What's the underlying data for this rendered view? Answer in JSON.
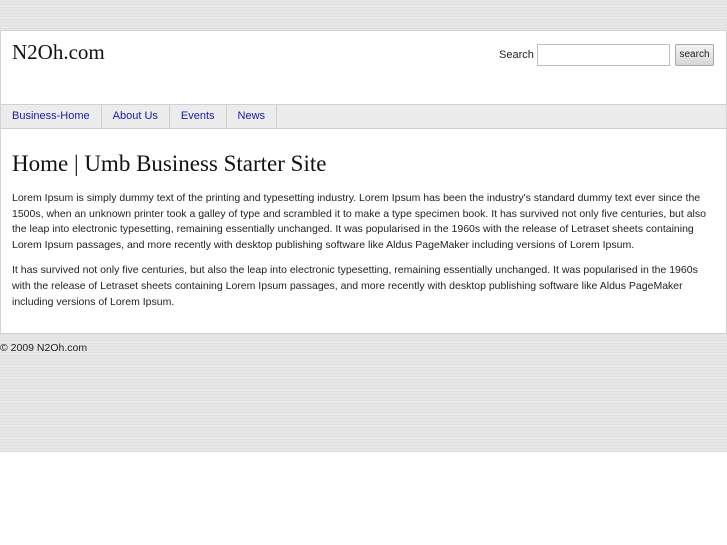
{
  "header": {
    "site_title": "N2Oh.com",
    "search_label": "Search",
    "search_value": "",
    "search_button": "search"
  },
  "nav": {
    "items": [
      {
        "label": "Business-Home"
      },
      {
        "label": "About Us"
      },
      {
        "label": "Events"
      },
      {
        "label": "News"
      }
    ]
  },
  "main": {
    "title": "Home | Umb Business Starter Site",
    "paragraphs": [
      "Lorem Ipsum is simply dummy text of the printing and typesetting industry. Lorem Ipsum has been the industry's standard dummy text ever since the 1500s, when an unknown printer took a galley of type and scrambled it to make a type specimen book. It has survived not only five centuries, but also the leap into electronic typesetting, remaining essentially unchanged. It was popularised in the 1960s with the release of Letraset sheets containing Lorem Ipsum passages, and more recently with desktop publishing software like Aldus PageMaker including versions of Lorem Ipsum.",
      "It has survived not only five centuries, but also the leap into electronic typesetting, remaining essentially unchanged. It was popularised in the 1960s with the release of Letraset sheets containing Lorem Ipsum passages, and more recently with desktop publishing software like Aldus PageMaker including versions of Lorem Ipsum."
    ]
  },
  "footer": {
    "copyright": "© 2009 N2Oh.com"
  },
  "colors": {
    "background": "#e8e8e8",
    "nav_background": "#ececec",
    "link": "#1a1aa8",
    "text": "#222222"
  }
}
